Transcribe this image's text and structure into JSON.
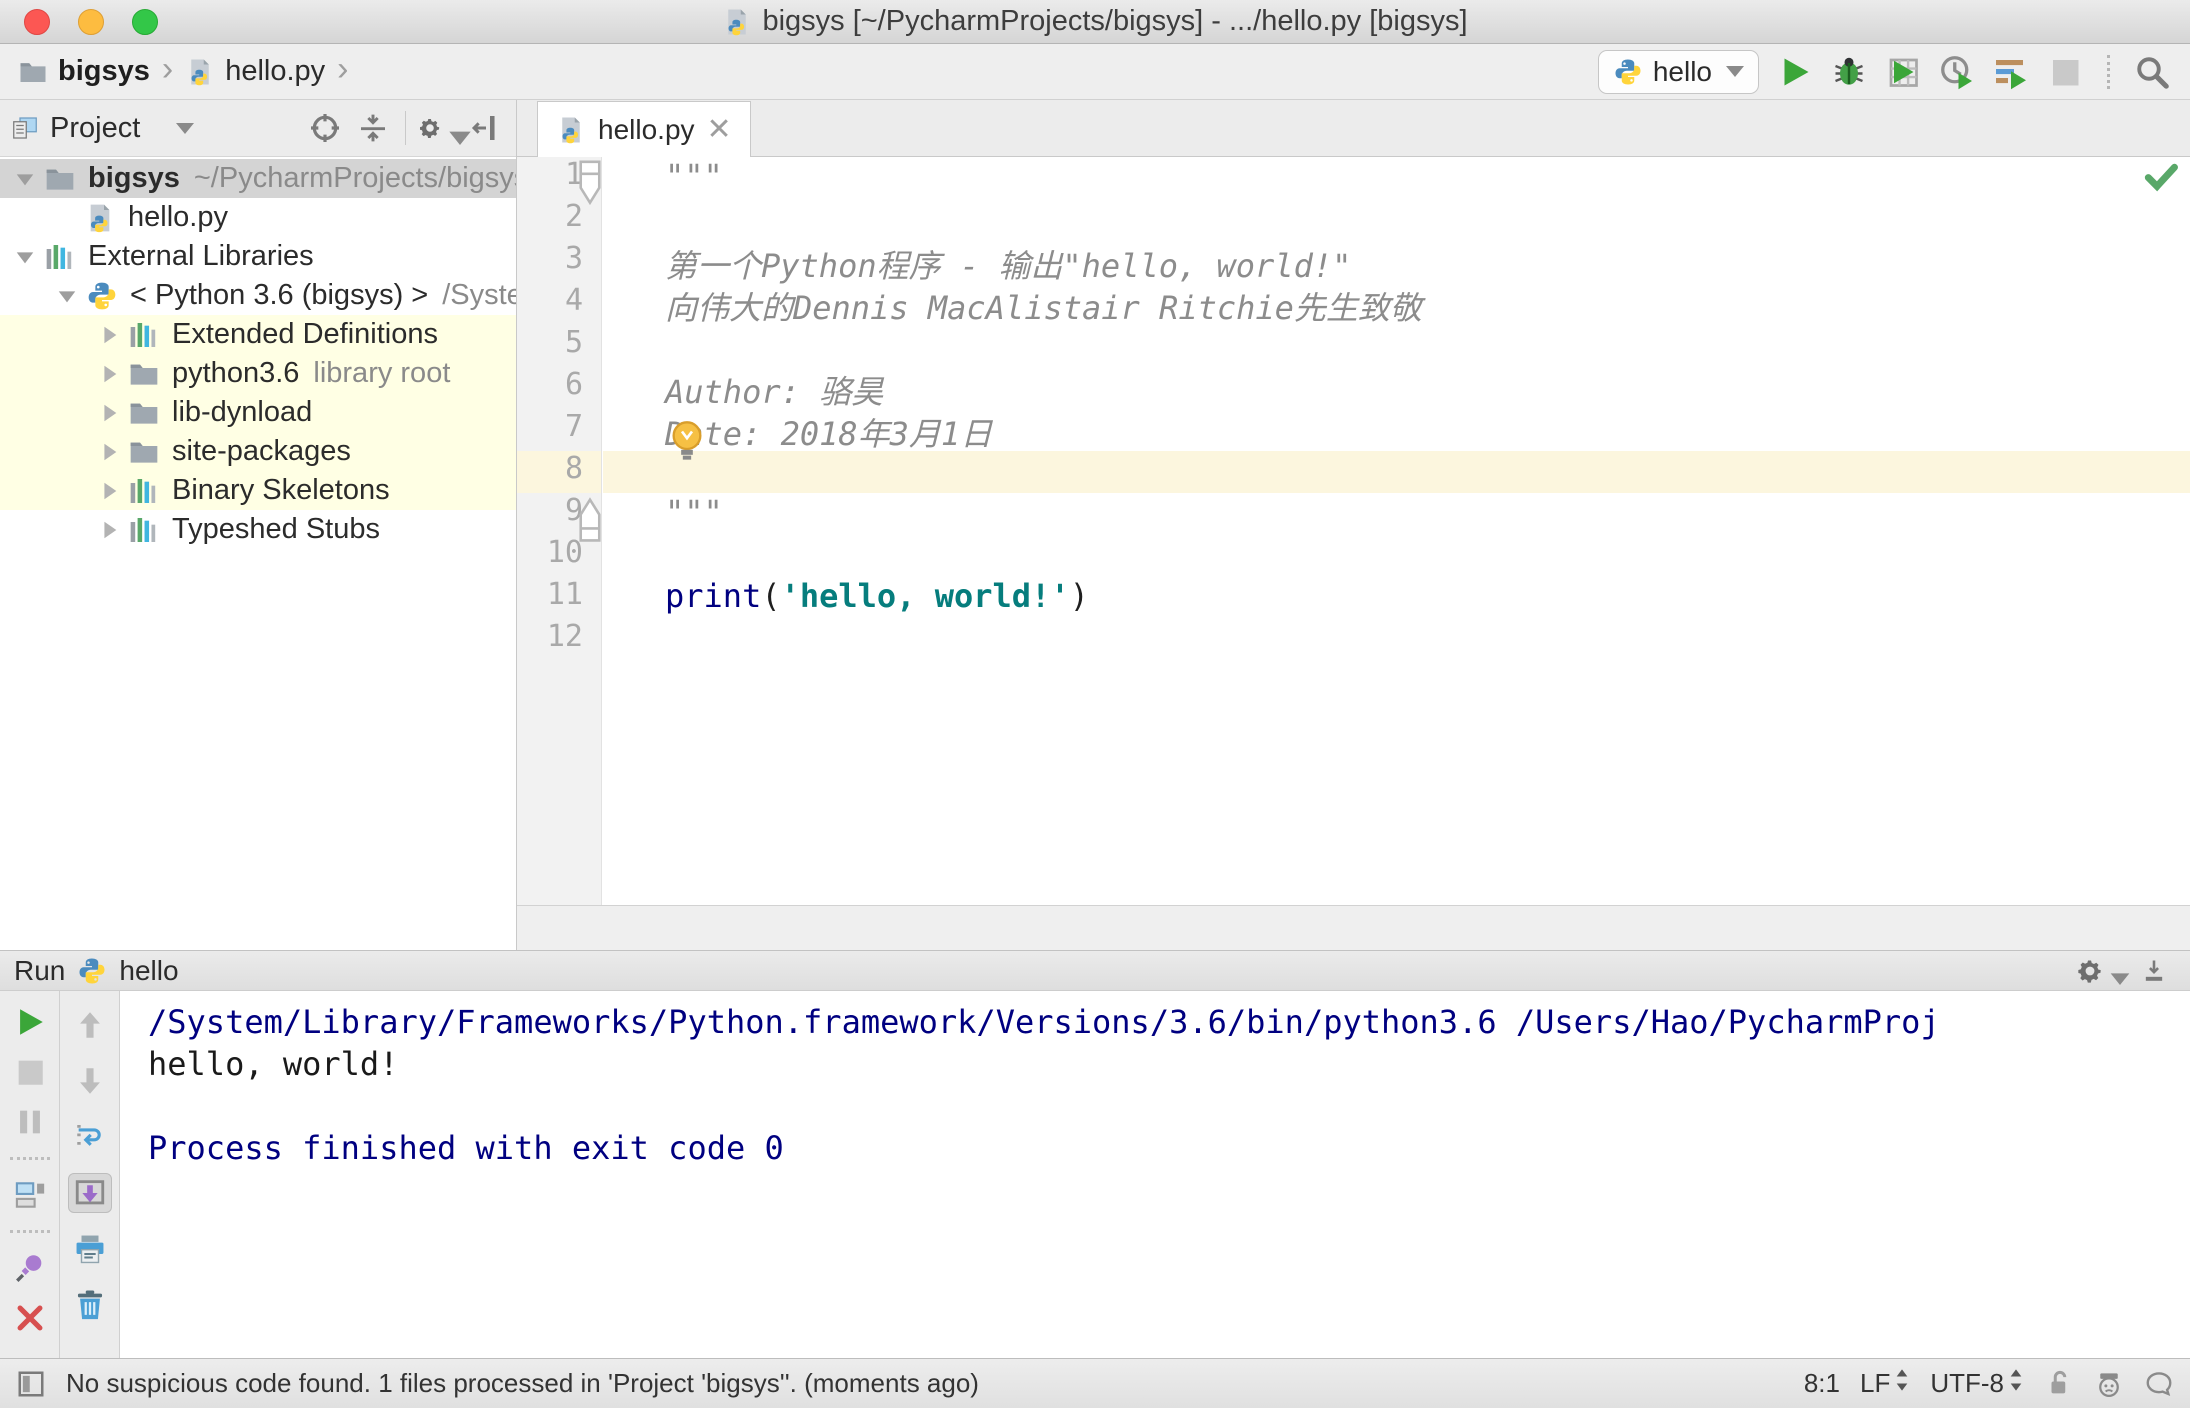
{
  "window": {
    "title": "bigsys [~/PycharmProjects/bigsys] - .../hello.py [bigsys]"
  },
  "breadcrumb": {
    "items": [
      "bigsys",
      "hello.py"
    ]
  },
  "run_widget": {
    "config": "hello"
  },
  "main_toolbar": {
    "buttons": [
      {
        "name": "run-button",
        "icon": "run"
      },
      {
        "name": "debug-button",
        "icon": "debug"
      },
      {
        "name": "run-with-coverage-button",
        "icon": "coverage"
      },
      {
        "name": "profile-button",
        "icon": "profile"
      },
      {
        "name": "concurrency-diagram-button",
        "icon": "concurrency"
      },
      {
        "name": "stop-button",
        "icon": "stop"
      }
    ],
    "search": {
      "name": "search-everywhere-button",
      "icon": "search"
    }
  },
  "project_panel": {
    "title": "Project",
    "items": [
      {
        "label": "bigsys",
        "suffix": "~/PycharmProjects/bigsys",
        "icon": "folder",
        "arrow": "down",
        "indent": 8,
        "bg": "selected",
        "bold": true
      },
      {
        "label": "hello.py",
        "suffix": "",
        "icon": "pyfile",
        "arrow": "none",
        "indent": 48,
        "bg": "none",
        "bold": false
      },
      {
        "label": "External Libraries",
        "suffix": "",
        "icon": "library",
        "arrow": "down",
        "indent": 8,
        "bg": "none",
        "bold": false
      },
      {
        "label": "< Python 3.6 (bigsys) >",
        "suffix": "/System",
        "icon": "python",
        "arrow": "down",
        "indent": 50,
        "bg": "none",
        "bold": false
      },
      {
        "label": "Extended Definitions",
        "suffix": "",
        "icon": "library",
        "arrow": "right",
        "indent": 92,
        "bg": "yellow",
        "bold": false
      },
      {
        "label": "python3.6",
        "suffix": "library root",
        "icon": "folder",
        "arrow": "right",
        "indent": 92,
        "bg": "yellow",
        "bold": false
      },
      {
        "label": "lib-dynload",
        "suffix": "",
        "icon": "folder",
        "arrow": "right",
        "indent": 92,
        "bg": "yellow",
        "bold": false
      },
      {
        "label": "site-packages",
        "suffix": "",
        "icon": "folder",
        "arrow": "right",
        "indent": 92,
        "bg": "yellow",
        "bold": false
      },
      {
        "label": "Binary Skeletons",
        "suffix": "",
        "icon": "library",
        "arrow": "right",
        "indent": 92,
        "bg": "yellow",
        "bold": false
      },
      {
        "label": "Typeshed Stubs",
        "suffix": "",
        "icon": "library",
        "arrow": "right",
        "indent": 92,
        "bg": "none",
        "bold": false
      }
    ]
  },
  "editor": {
    "tab": {
      "label": "hello.py"
    },
    "lines": [
      {
        "num": 1,
        "fold": "start",
        "highlight": false,
        "segments": [
          {
            "t": "\"\"\"",
            "s": "comment"
          }
        ]
      },
      {
        "num": 2,
        "fold": "",
        "highlight": false,
        "segments": []
      },
      {
        "num": 3,
        "fold": "",
        "highlight": false,
        "segments": [
          {
            "t": "第一个Python程序 - 输出\"hello, world!\"",
            "s": "comment"
          }
        ]
      },
      {
        "num": 4,
        "fold": "",
        "highlight": false,
        "segments": [
          {
            "t": "向伟大的Dennis MacAlistair Ritchie先生致敬",
            "s": "comment"
          }
        ]
      },
      {
        "num": 5,
        "fold": "",
        "highlight": false,
        "segments": []
      },
      {
        "num": 6,
        "fold": "",
        "highlight": false,
        "segments": [
          {
            "t": "Author: 骆昊",
            "s": "comment"
          }
        ]
      },
      {
        "num": 7,
        "fold": "",
        "highlight": false,
        "segments": [
          {
            "t": "Date: 2018年3月1日",
            "s": "comment"
          }
        ],
        "bulb": true
      },
      {
        "num": 8,
        "fold": "",
        "highlight": true,
        "segments": []
      },
      {
        "num": 9,
        "fold": "end",
        "highlight": false,
        "segments": [
          {
            "t": "\"\"\"",
            "s": "comment"
          }
        ]
      },
      {
        "num": 10,
        "fold": "",
        "highlight": false,
        "segments": []
      },
      {
        "num": 11,
        "fold": "",
        "highlight": false,
        "segments": [
          {
            "t": "print",
            "s": "keyword"
          },
          {
            "t": "(",
            "s": "plain"
          },
          {
            "t": "'hello, world!'",
            "s": "string"
          },
          {
            "t": ")",
            "s": "plain"
          }
        ]
      },
      {
        "num": 12,
        "fold": "",
        "highlight": false,
        "segments": []
      }
    ]
  },
  "run_panel": {
    "label": "Run",
    "config": "hello",
    "toolbar_col1": [
      "rerun",
      "stop",
      "pause",
      "sep",
      "layout",
      "sep",
      "pin",
      "close",
      "more"
    ],
    "toolbar_col2": [
      "up",
      "down",
      "softwrap",
      "scrollend",
      "print",
      "trash"
    ],
    "console": [
      {
        "text": "/System/Library/Frameworks/Python.framework/Versions/3.6/bin/python3.6 /Users/Hao/PycharmProj",
        "style": "sys"
      },
      {
        "text": "hello, world!",
        "style": "out"
      },
      {
        "text": "",
        "style": "out"
      },
      {
        "text": "Process finished with exit code 0",
        "style": "sys"
      }
    ]
  },
  "status_bar": {
    "message": "No suspicious code found. 1 files processed in 'Project 'bigsys''. (moments ago)",
    "caret": "8:1",
    "line_sep": "LF",
    "encoding": "UTF-8"
  }
}
